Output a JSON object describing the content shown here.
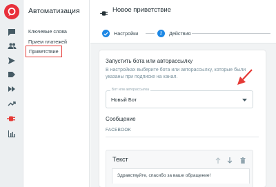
{
  "sidebar": {
    "title": "Автоматизация",
    "items": [
      {
        "label": "Ключевые слова",
        "active": false
      },
      {
        "label": "Прием платежей",
        "active": false
      },
      {
        "label": "Приветствие",
        "active": true
      }
    ]
  },
  "header": {
    "title": "Новое приветствие",
    "steps": [
      {
        "number": "",
        "label": "Настройки",
        "done": true
      },
      {
        "number": "2",
        "label": "Действия",
        "done": false
      }
    ]
  },
  "launch": {
    "title": "Запустить бота или авторассылку",
    "description": "В настройках выберите бота или авторассылку, которые были указаны при подписке на канал.",
    "select_label": "Бот или авторассылка",
    "select_value": "Новый Бот"
  },
  "message": {
    "title": "Сообщение",
    "tab": "FACEBOOK",
    "block_title": "Текст",
    "text_value": "Здравствуйте, спасибо за ваше обращение!"
  },
  "colors": {
    "accent": "#1e88e5",
    "brand": "#e8303b",
    "highlight": "#e53935"
  }
}
